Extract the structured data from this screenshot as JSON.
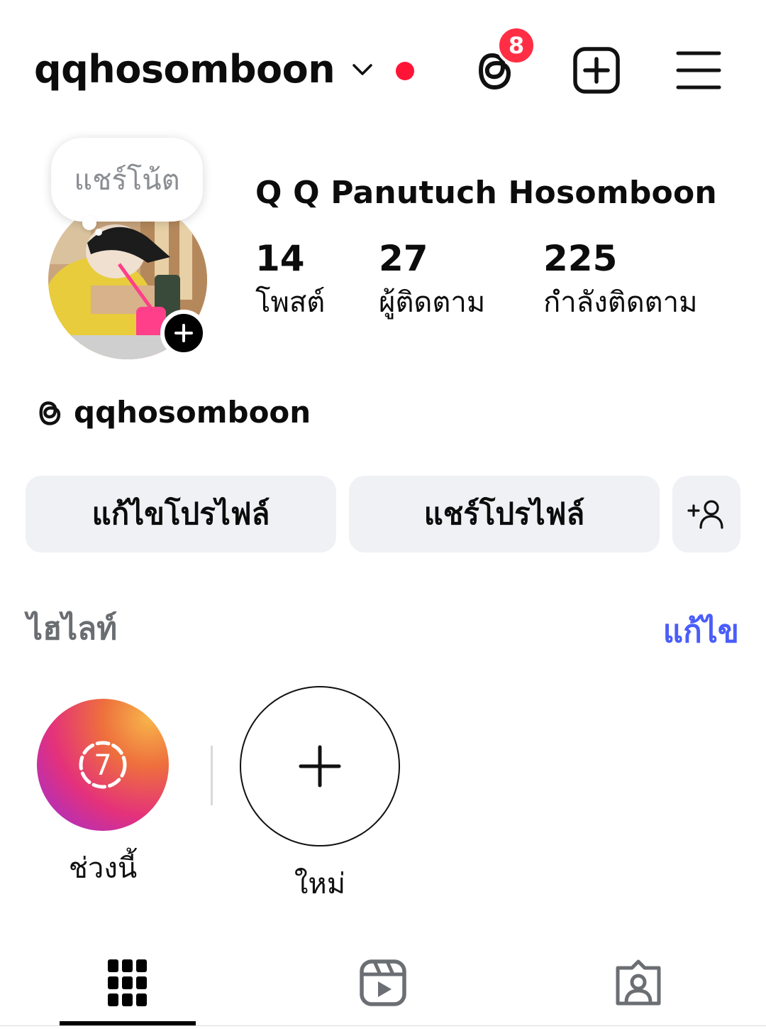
{
  "header": {
    "username": "qqhosomboon",
    "notification_count": "8"
  },
  "note": {
    "text": "แชร์โน้ต"
  },
  "profile": {
    "full_name": "Q Q Panutuch Hosomboon",
    "stats": [
      {
        "value": "14",
        "label": "โพสต์"
      },
      {
        "value": "27",
        "label": "ผู้ติดตาม"
      },
      {
        "value": "225",
        "label": "กำลังติดตาม"
      }
    ],
    "threads_handle": "qqhosomboon"
  },
  "buttons": {
    "edit_profile": "แก้ไขโปรไฟล์",
    "share_profile": "แชร์โปรไฟล์"
  },
  "highlights": {
    "title": "ไฮไลท์",
    "edit": "แก้ไข",
    "items": [
      {
        "label": "ช่วงนี้",
        "badge": "7"
      },
      {
        "label": "ใหม่"
      }
    ]
  },
  "tabs": [
    {
      "icon": "grid-icon",
      "active": true
    },
    {
      "icon": "reels-icon",
      "active": false
    },
    {
      "icon": "tagged-icon",
      "active": false
    }
  ],
  "colors": {
    "accent": "#4a5df9",
    "notification": "#ff2e45",
    "button_bg": "#eff1f4"
  }
}
